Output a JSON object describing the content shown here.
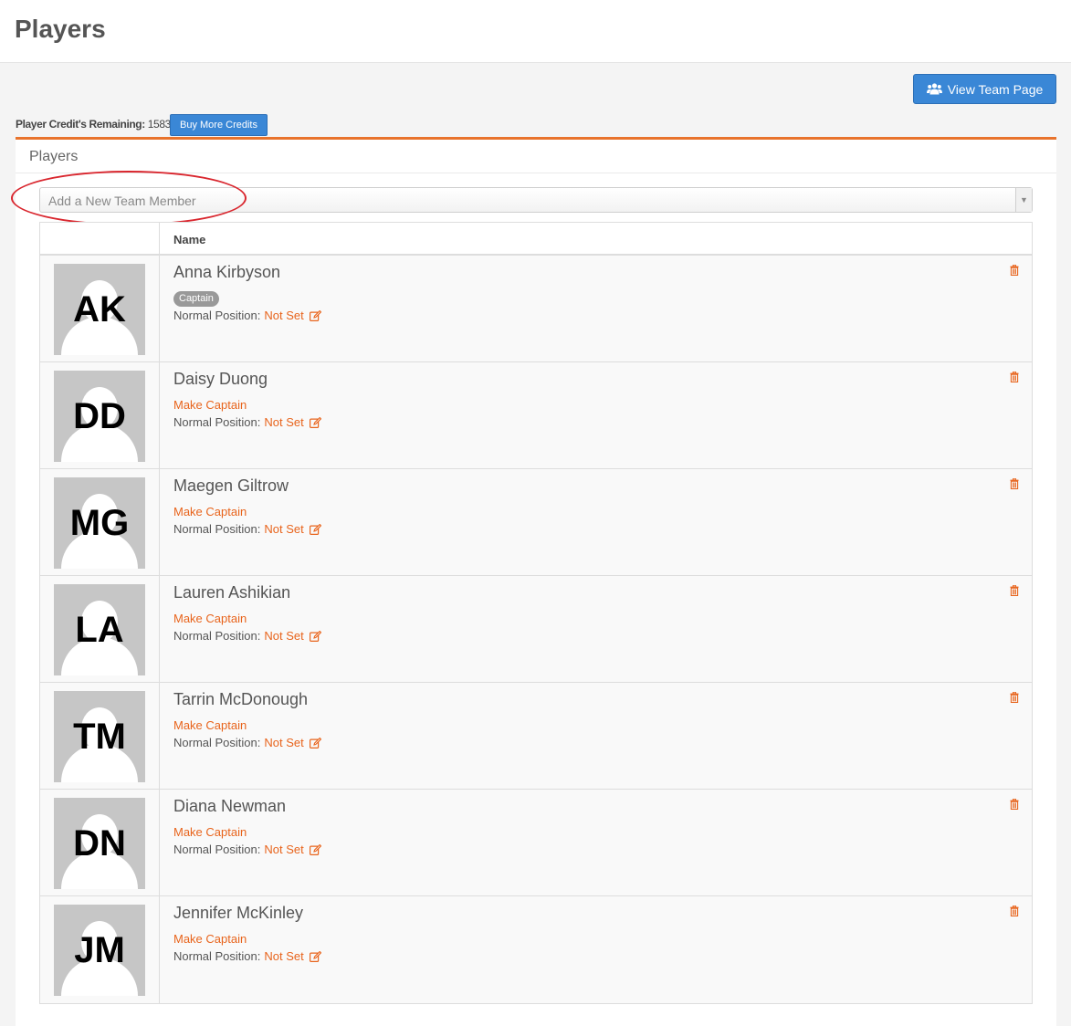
{
  "header": {
    "title": "Players"
  },
  "actions": {
    "view_team_label": "View Team Page",
    "view_team_icon": "users-icon"
  },
  "credits": {
    "label": "Player Credit's Remaining:",
    "value": "1583",
    "buy_label": "Buy More Credits"
  },
  "panel": {
    "title": "Players"
  },
  "add_member": {
    "placeholder": "Add a New Team Member"
  },
  "table": {
    "columns": [
      "",
      "Name"
    ]
  },
  "colors": {
    "accent": "#e8641c",
    "primary": "#3a87d6",
    "highlight": "#d9262e"
  },
  "players": [
    {
      "initials": "AK",
      "name": "Anna Kirbyson",
      "role": "Captain",
      "position_label": "Normal Position:",
      "position": "Not Set"
    },
    {
      "initials": "DD",
      "name": "Daisy Duong",
      "role": "Make Captain",
      "position_label": "Normal Position:",
      "position": "Not Set"
    },
    {
      "initials": "MG",
      "name": "Maegen Giltrow",
      "role": "Make Captain",
      "position_label": "Normal Position:",
      "position": "Not Set"
    },
    {
      "initials": "LA",
      "name": "Lauren Ashikian",
      "role": "Make Captain",
      "position_label": "Normal Position:",
      "position": "Not Set"
    },
    {
      "initials": "TM",
      "name": "Tarrin McDonough",
      "role": "Make Captain",
      "position_label": "Normal Position:",
      "position": "Not Set"
    },
    {
      "initials": "DN",
      "name": "Diana Newman",
      "role": "Make Captain",
      "position_label": "Normal Position:",
      "position": "Not Set"
    },
    {
      "initials": "JM",
      "name": "Jennifer McKinley",
      "role": "Make Captain",
      "position_label": "Normal Position:",
      "position": "Not Set"
    }
  ]
}
